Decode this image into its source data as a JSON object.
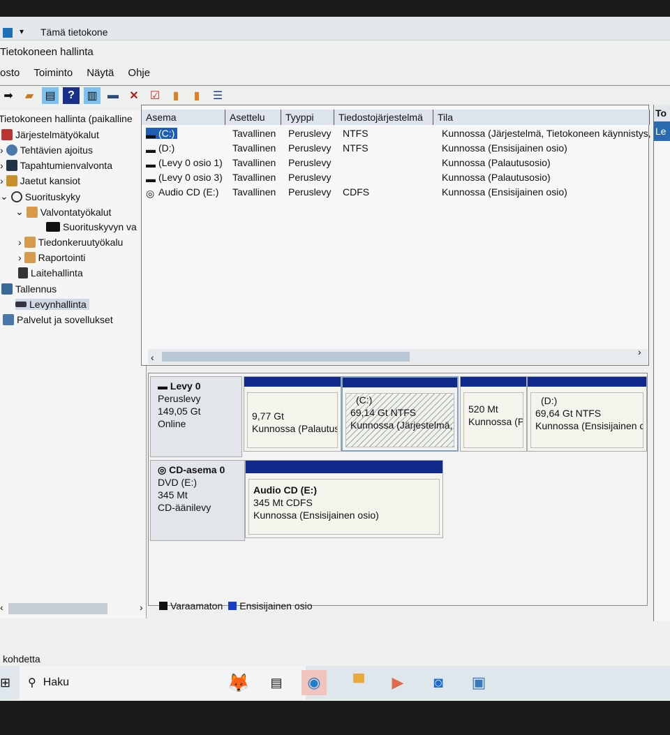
{
  "window": {
    "title": "Tämä tietokone",
    "app_title": "Tietokoneen hallinta"
  },
  "menu": [
    "osto",
    "Toiminto",
    "Näytä",
    "Ohje"
  ],
  "toolbar": {
    "icons": [
      "forward-icon",
      "folder-up-icon",
      "show-hide-console-tree-icon",
      "help-icon",
      "show-hide-action-pane-icon",
      "connect-icon",
      "delete-icon",
      "properties-icon",
      "export-icon",
      "find-icon",
      "checklist-icon"
    ]
  },
  "tree": {
    "root": "Tietokoneen hallinta (paikalline",
    "items": [
      {
        "label": "Järjestelmätyökalut"
      },
      {
        "label": "Tehtävien ajoitus"
      },
      {
        "label": "Tapahtumienvalvonta"
      },
      {
        "label": "Jaetut kansiot"
      },
      {
        "label": "Suorituskyky"
      },
      {
        "label": "Valvontatyökalut"
      },
      {
        "label": "Suorituskyvyn va"
      },
      {
        "label": "Tiedonkeruutyökalu"
      },
      {
        "label": "Raportointi"
      },
      {
        "label": "Laitehallinta"
      },
      {
        "label": "Tallennus"
      },
      {
        "label": "Levynhallinta"
      },
      {
        "label": "Palvelut ja sovellukset"
      }
    ]
  },
  "volumes": {
    "columns": [
      "Asema",
      "Asettelu",
      "Tyyppi",
      "Tiedostojärjestelmä",
      "Tila"
    ],
    "rows": [
      [
        "(C:)",
        "Tavallinen",
        "Peruslevy",
        "NTFS",
        "Kunnossa (Järjestelmä, Tietokoneen käynnistys,"
      ],
      [
        "(D:)",
        "Tavallinen",
        "Peruslevy",
        "NTFS",
        "Kunnossa (Ensisijainen osio)"
      ],
      [
        "(Levy 0 osio 1)",
        "Tavallinen",
        "Peruslevy",
        "",
        "Kunnossa (Palautusosio)"
      ],
      [
        "(Levy 0 osio 3)",
        "Tavallinen",
        "Peruslevy",
        "",
        "Kunnossa (Palautusosio)"
      ],
      [
        "Audio CD (E:)",
        "Tavallinen",
        "Peruslevy",
        "CDFS",
        "Kunnossa (Ensisijainen osio)"
      ]
    ]
  },
  "disks": [
    {
      "name": "Levy 0",
      "type": "Peruslevy",
      "size": "149,05 Gt",
      "status": "Online",
      "partitions": [
        {
          "name": "",
          "size": "9,77 Gt",
          "status": "Kunnossa (Palautus"
        },
        {
          "name": "(C:)",
          "size": "69,14 Gt NTFS",
          "status": "Kunnossa (Järjestelmä, T"
        },
        {
          "name": "",
          "size": "520 Mt",
          "status": "Kunnossa (P"
        },
        {
          "name": "(D:)",
          "size": "69,64 Gt NTFS",
          "status": "Kunnossa (Ensisijainen c"
        }
      ]
    },
    {
      "name": "CD-asema 0",
      "type": "DVD (E:)",
      "size": "345 Mt",
      "status": "CD-äänilevy",
      "partitions": [
        {
          "name": "Audio CD  (E:)",
          "size": "345 Mt CDFS",
          "status": "Kunnossa (Ensisijainen osio)"
        }
      ]
    }
  ],
  "legend": [
    {
      "label": "Varaamaton",
      "color": "#111111"
    },
    {
      "label": "Ensisijainen osio",
      "color": "#1a3fc4"
    }
  ],
  "actions": {
    "header": "To",
    "item": "Le"
  },
  "status": "kohdetta",
  "taskbar": {
    "search": "Haku"
  },
  "colors": {
    "partition_bar": "#0f2a8a",
    "selection": "#1e5fb4"
  }
}
